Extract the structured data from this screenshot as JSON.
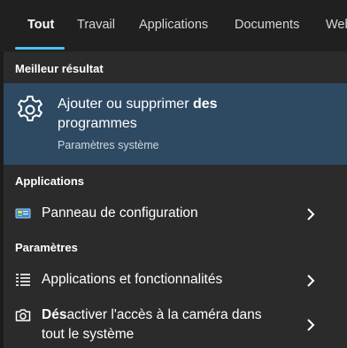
{
  "tabs": [
    {
      "label": "Tout",
      "active": true
    },
    {
      "label": "Travail",
      "active": false
    },
    {
      "label": "Applications",
      "active": false
    },
    {
      "label": "Documents",
      "active": false
    },
    {
      "label": "Web",
      "active": false
    }
  ],
  "best_match": {
    "header": "Meilleur résultat",
    "title_normal": "Ajouter ou supprimer ",
    "title_bold": "des",
    "title_line2": "programmes",
    "subtitle": "Paramètres système",
    "icon": "gear-icon"
  },
  "apps_section": {
    "header": "Applications",
    "items": [
      {
        "label": "Panneau de configuration",
        "icon": "control-panel-icon"
      }
    ]
  },
  "settings_section": {
    "header": "Paramètres",
    "items": [
      {
        "label": "Applications et fonctionnalités",
        "icon": "list-icon"
      },
      {
        "label_bold": "Dés",
        "label_rest": "activer l'accès à la caméra dans",
        "label_line2": "tout le système",
        "icon": "camera-icon"
      }
    ]
  },
  "colors": {
    "accent": "#4cc2ff",
    "selected_bg": "#2e4a62",
    "panel_bg": "#2b2b2b",
    "topbar_bg": "#202020"
  }
}
